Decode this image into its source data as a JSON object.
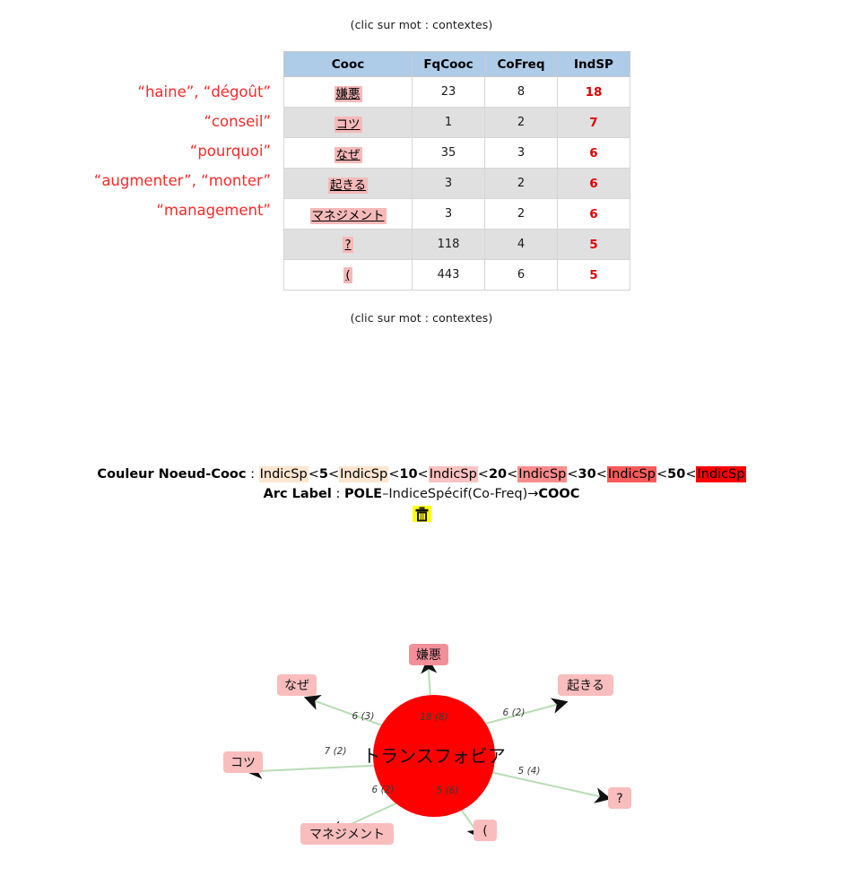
{
  "captions": {
    "top": "(clic sur mot : contextes)",
    "bottom": "(clic sur mot : contextes)"
  },
  "table": {
    "headers": {
      "cooc": "Cooc",
      "fqcooc": "FqCooc",
      "cofreq": "CoFreq",
      "indsp": "IndSP"
    },
    "rows": [
      {
        "cooc": "嫌悪",
        "fqcooc": "23",
        "cofreq": "8",
        "indsp": "18",
        "annotation": "“haine”, “dégoût”"
      },
      {
        "cooc": "コツ",
        "fqcooc": "1",
        "cofreq": "2",
        "indsp": "7",
        "annotation": "“conseil”"
      },
      {
        "cooc": "なぜ",
        "fqcooc": "35",
        "cofreq": "3",
        "indsp": "6",
        "annotation": "“pourquoi”"
      },
      {
        "cooc": "起きる",
        "fqcooc": "3",
        "cofreq": "2",
        "indsp": "6",
        "annotation": "“augmenter”, “monter”"
      },
      {
        "cooc": "マネジメント",
        "fqcooc": "3",
        "cofreq": "2",
        "indsp": "6",
        "annotation": "“management”"
      },
      {
        "cooc": "?",
        "fqcooc": "118",
        "cofreq": "4",
        "indsp": "5",
        "annotation": ""
      },
      {
        "cooc": "(",
        "fqcooc": "443",
        "cofreq": "6",
        "indsp": "5",
        "annotation": ""
      }
    ]
  },
  "legend": {
    "node_color_label": "Couleur Noeud-Cooc",
    "colon": " : ",
    "indicsp_text": "IndicSp",
    "thresholds": [
      "5",
      "10",
      "20",
      "30",
      "50"
    ],
    "lt": "<",
    "swatches": [
      "#fde6cf",
      "#fbc2c2",
      "#fb8c8c",
      "#fb5a5a",
      "#fe0000"
    ],
    "arc_label_title": "Arc Label",
    "arc_pole": "POLE",
    "arc_dash": "–",
    "arc_middle": "IndiceSpécif(Co-Freq)",
    "arc_arrow": "→",
    "arc_cooc": "COOC",
    "trash_icon": "trash-icon",
    "trash_highlight": "#ffff00"
  },
  "graph": {
    "center": {
      "label": "トランスフォビア",
      "color": "#fe0000"
    },
    "edge_color": "#b8ddb4",
    "nodes": [
      {
        "id": "kenno",
        "label": "嫌悪",
        "edge_label": "18 (8)",
        "color": "#f2909a"
      },
      {
        "id": "okiru",
        "label": "起きる",
        "edge_label": "6 (2)",
        "color": "#f9bdbd"
      },
      {
        "id": "question",
        "label": "?",
        "edge_label": "5 (4)",
        "color": "#f9bdbd"
      },
      {
        "id": "paren",
        "label": "(",
        "edge_label": "5 (6)",
        "color": "#f9bdbd"
      },
      {
        "id": "manage",
        "label": "マネジメント",
        "edge_label": "6 (2)",
        "color": "#f9bdbd"
      },
      {
        "id": "kotsu",
        "label": "コツ",
        "edge_label": "7 (2)",
        "color": "#f9bdbd"
      },
      {
        "id": "naze",
        "label": "なぜ",
        "edge_label": "6 (3)",
        "color": "#f9bdbd"
      }
    ]
  }
}
